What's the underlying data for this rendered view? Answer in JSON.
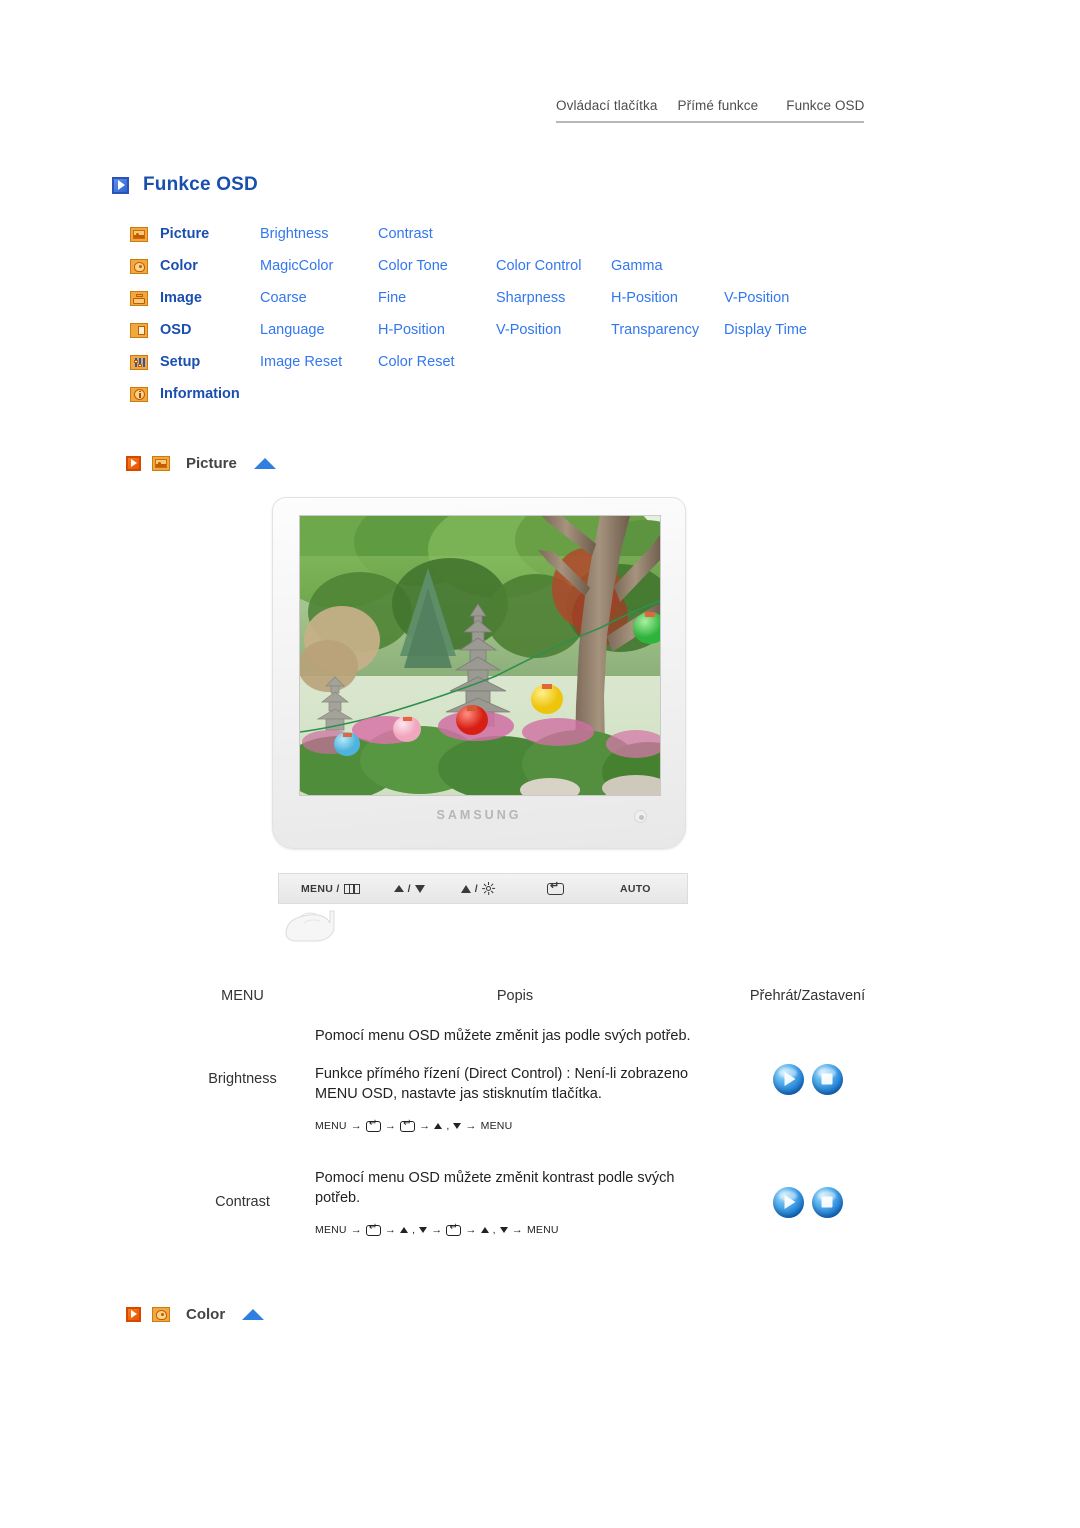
{
  "breadcrumb": {
    "items": [
      "Ovládací tlačítka",
      "Přímé funkce",
      "Funkce OSD"
    ]
  },
  "page_title": "Funkce OSD",
  "menu_matrix": {
    "rows": [
      {
        "icon": "picture-icon",
        "category": "Picture",
        "subitems": [
          "Brightness",
          "Contrast"
        ]
      },
      {
        "icon": "color-icon",
        "category": "Color",
        "subitems": [
          "MagicColor",
          "Color Tone",
          "Color Control",
          "Gamma"
        ]
      },
      {
        "icon": "image-icon",
        "category": "Image",
        "subitems": [
          "Coarse",
          "Fine",
          "Sharpness",
          "H-Position",
          "V-Position"
        ]
      },
      {
        "icon": "osd-icon",
        "category": "OSD",
        "subitems": [
          "Language",
          "H-Position",
          "V-Position",
          "Transparency",
          "Display Time"
        ]
      },
      {
        "icon": "setup-icon",
        "category": "Setup",
        "subitems": [
          "Image Reset",
          "Color Reset"
        ]
      },
      {
        "icon": "information-icon",
        "category": "Information",
        "subitems": []
      }
    ]
  },
  "sections": [
    {
      "label": "Picture",
      "icon": "picture-icon"
    },
    {
      "label": "Color",
      "icon": "color-icon"
    }
  ],
  "monitor": {
    "brand": "SAMSUNG",
    "screen_alt": "Korean garden with stone pagoda, trees and colored paper lanterns"
  },
  "button_bar": {
    "buttons": [
      {
        "label": "MENU /",
        "icon": "menu-grid-icon"
      },
      {
        "label": "",
        "icon": "mountain-down-icon"
      },
      {
        "label": "",
        "icon": "up-brightness-icon"
      },
      {
        "label": "",
        "icon": "enter-icon"
      },
      {
        "label": "AUTO",
        "icon": "auto-label"
      }
    ],
    "auto_label": "AUTO",
    "menu_label": "MENU /"
  },
  "table": {
    "headers": [
      "MENU",
      "Popis",
      "Přehrát/Zastavení"
    ],
    "rows": [
      {
        "menu": "Brightness",
        "desc1": "Pomocí menu OSD můžete změnit jas podle svých potřeb.",
        "desc2": "Funkce přímého řízení (Direct Control) : Není-li zobrazeno MENU OSD, nastavte jas stisknutím tlačítka.",
        "sequence": [
          "MENU",
          "→",
          "enter",
          "→",
          "enter",
          "→",
          "▲ , ▼",
          "→",
          "MENU"
        ],
        "controls": [
          "play",
          "stop"
        ]
      },
      {
        "menu": "Contrast",
        "desc1": "Pomocí menu OSD můžete změnit kontrast podle svých potřeb.",
        "desc2": "",
        "sequence": [
          "MENU",
          "→",
          "enter",
          "→",
          "▲ , ▼",
          "→",
          "enter",
          "→",
          "▲ , ▼",
          "→",
          "MENU"
        ],
        "controls": [
          "play",
          "stop"
        ]
      }
    ]
  },
  "colors": {
    "link_blue": "#3377ee",
    "heading_blue": "#1a4fb0",
    "accent_orange": "#e85400",
    "icon_gold": "#f0a840",
    "ball_blue": "#1b78d0"
  },
  "labels": {
    "seq_menu": "MENU",
    "seq_arrow": "→",
    "seq_updown": "▲ , ▼"
  }
}
